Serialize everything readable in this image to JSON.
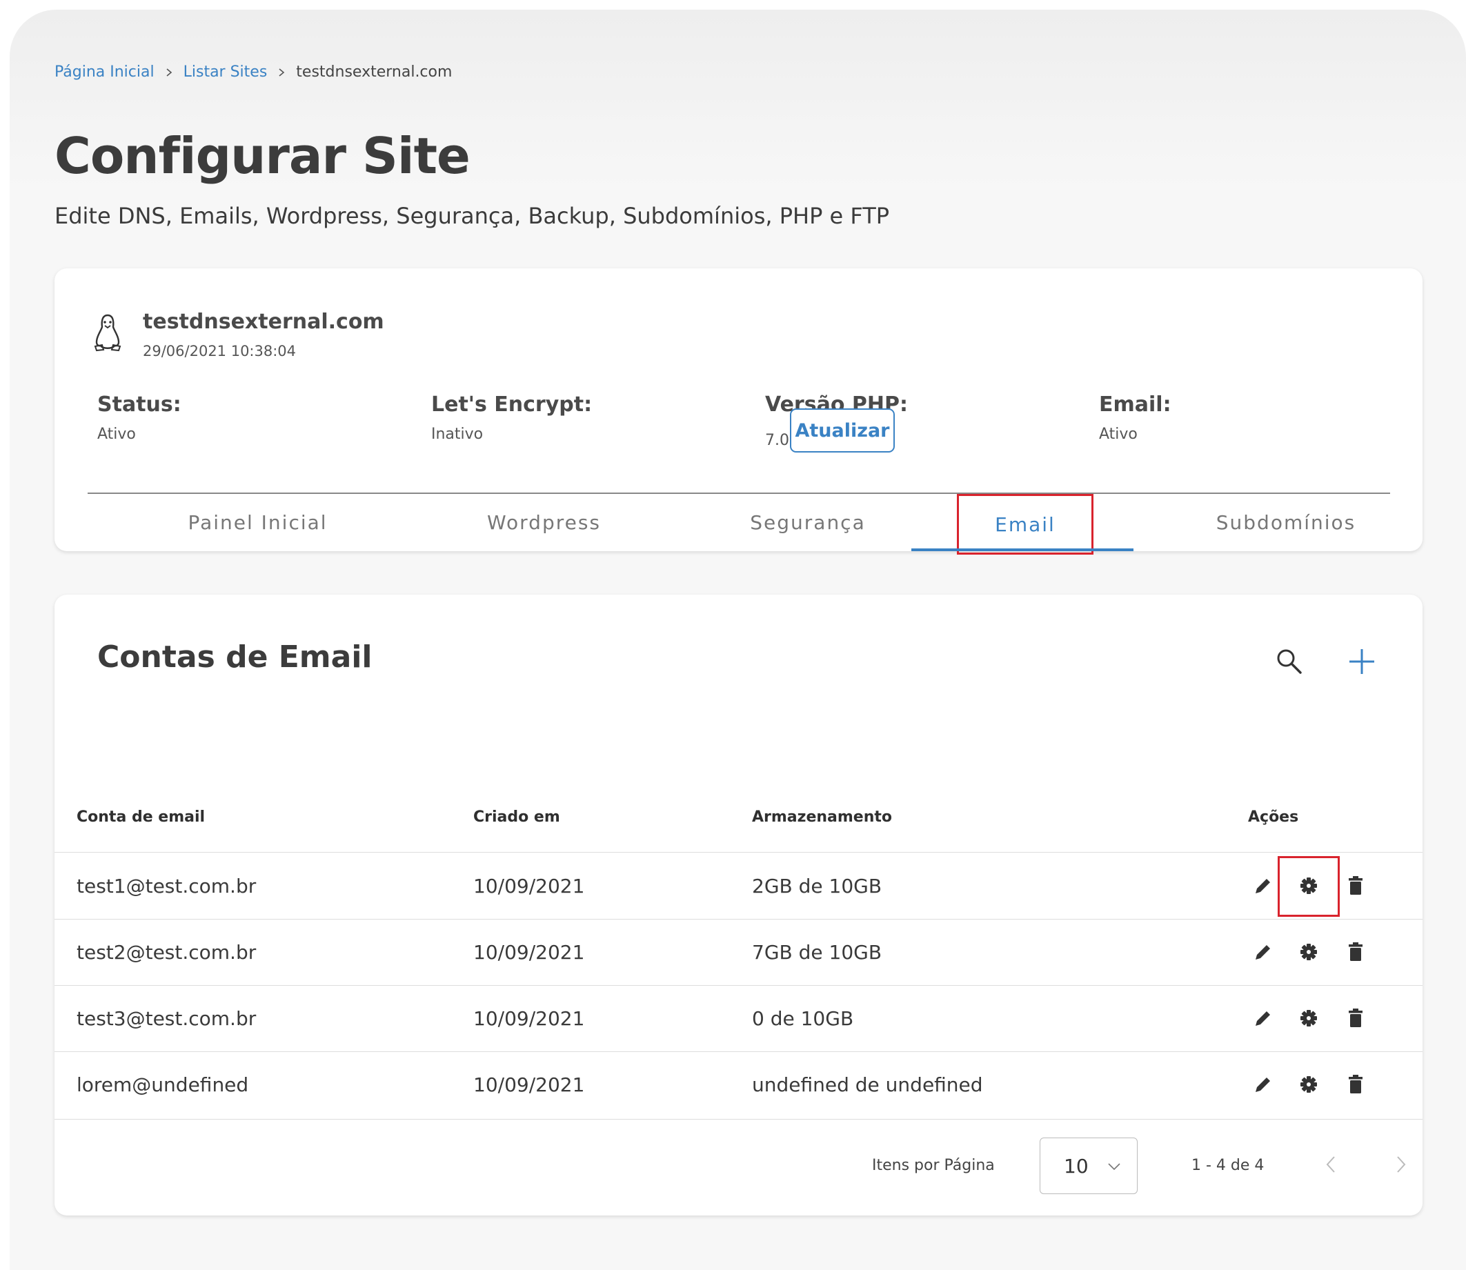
{
  "breadcrumb": {
    "items": [
      "Página Inicial",
      "Listar Sites"
    ],
    "current": "testdnsexternal.com"
  },
  "page": {
    "title": "Configurar Site",
    "subtitle": "Edite DNS, Emails, Wordpress, Segurança, Backup, Subdomínios, PHP e FTP"
  },
  "site": {
    "icon": "linux-tux-icon",
    "name": "testdnsexternal.com",
    "created": "29/06/2021 10:38:04",
    "status_label": "Status:",
    "status_value": "Ativo",
    "ssl_label": "Let's Encrypt:",
    "ssl_value": "Inativo",
    "php_label": "Versão PHP:",
    "php_value": "7.0",
    "php_update_label": "Atualizar",
    "email_label": "Email:",
    "email_value": "Ativo"
  },
  "tabs": [
    {
      "label": "Painel Inicial"
    },
    {
      "label": "Wordpress"
    },
    {
      "label": "Segurança"
    },
    {
      "label": "Email",
      "active": true
    },
    {
      "label": "Subdomínios"
    }
  ],
  "email_section": {
    "title": "Contas de Email",
    "columns": [
      "Conta de email",
      "Criado em",
      "Armazenamento",
      "Ações"
    ],
    "rows": [
      {
        "account": "test1@test.com.br",
        "created": "10/09/2021",
        "storage": "2GB de 10GB"
      },
      {
        "account": "test2@test.com.br",
        "created": "10/09/2021",
        "storage": "7GB de 10GB"
      },
      {
        "account": "test3@test.com.br",
        "created": "10/09/2021",
        "storage": "0 de 10GB"
      },
      {
        "account": "lorem@undefined",
        "created": "10/09/2021",
        "storage": "undefined de undefined"
      }
    ],
    "footer": {
      "items_per_page_label": "Itens por Página",
      "items_per_page_value": "10",
      "range": "1 - 4 de 4"
    }
  },
  "colors": {
    "accent": "#3a82c4",
    "highlight": "#d9232d",
    "text_dark": "#3c3c3c",
    "background": "#f7f7f7"
  }
}
